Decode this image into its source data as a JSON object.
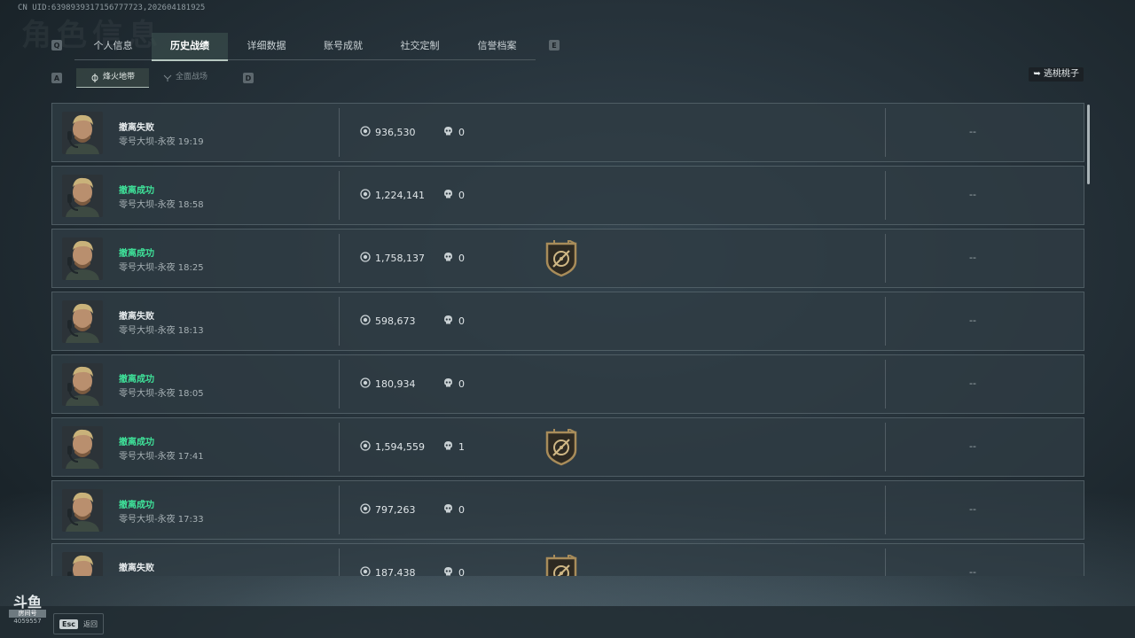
{
  "uid_text": "CN UID:6398939317156777723,202604181925",
  "background_title": "角色信息",
  "nav": {
    "left_key": "Q",
    "right_key": "E",
    "tabs": [
      "个人信息",
      "历史战绩",
      "详细数据",
      "账号成就",
      "社交定制",
      "信誉档案"
    ],
    "active_tab": "历史战绩"
  },
  "subnav": {
    "left_key": "A",
    "right_key": "D",
    "tabs": [
      "烽火地带",
      "全面战场"
    ],
    "active_tab": "烽火地带"
  },
  "account_name": "逃桃桃子",
  "records": [
    {
      "status": "撤离失败",
      "success": false,
      "map_time": "零号大坝-永夜 19:19",
      "value": "936,530",
      "kills": "0",
      "badge": false,
      "extra": "--"
    },
    {
      "status": "撤离成功",
      "success": true,
      "map_time": "零号大坝-永夜 18:58",
      "value": "1,224,141",
      "kills": "0",
      "badge": false,
      "extra": "--"
    },
    {
      "status": "撤离成功",
      "success": true,
      "map_time": "零号大坝-永夜 18:25",
      "value": "1,758,137",
      "kills": "0",
      "badge": true,
      "extra": "--"
    },
    {
      "status": "撤离失败",
      "success": false,
      "map_time": "零号大坝-永夜 18:13",
      "value": "598,673",
      "kills": "0",
      "badge": false,
      "extra": "--"
    },
    {
      "status": "撤离成功",
      "success": true,
      "map_time": "零号大坝-永夜 18:05",
      "value": "180,934",
      "kills": "0",
      "badge": false,
      "extra": "--"
    },
    {
      "status": "撤离成功",
      "success": true,
      "map_time": "零号大坝-永夜 17:41",
      "value": "1,594,559",
      "kills": "1",
      "badge": true,
      "extra": "--"
    },
    {
      "status": "撤离成功",
      "success": true,
      "map_time": "零号大坝-永夜 17:33",
      "value": "797,263",
      "kills": "0",
      "badge": false,
      "extra": "--"
    },
    {
      "status": "撤离失败",
      "success": false,
      "map_time": "零号大坝-永夜 17:19",
      "value": "187,438",
      "kills": "0",
      "badge": true,
      "extra": "--"
    }
  ],
  "footer": {
    "esc_key": "Esc",
    "back_label": "返回",
    "watermark_line1": "斗鱼",
    "watermark_line2": "房间号",
    "watermark_line3": "4059557"
  },
  "colors": {
    "success_green": "#3fe39a",
    "row_bg": "#303c44",
    "text": "#d6dde0"
  },
  "icons": {
    "currency": "coin-icon",
    "kills": "skull-icon",
    "badge": "shield-badge-icon",
    "account": "back-arrow-icon",
    "subtab": "crosshair-icon"
  }
}
